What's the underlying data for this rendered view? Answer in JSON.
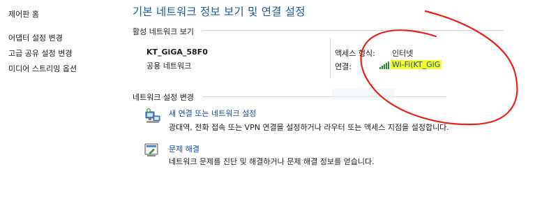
{
  "sidebar": {
    "control_panel_home": "제어판 홈",
    "items": [
      {
        "label": "어댑터 설정 변경"
      },
      {
        "label": "고급 공유 설정 변경"
      },
      {
        "label": "미디어 스트리밍 옵션"
      }
    ]
  },
  "main": {
    "title": "기본 네트워크 정보 보기 및 연결 설정",
    "active_networks": {
      "header": "활성 네트워크 보기",
      "network_name": "KT_GiGA_58F0",
      "network_category": "공용 네트워크",
      "access_type_label": "액세스 형식:",
      "access_type_value": "인터넷",
      "connections_label": "연결:",
      "connection_value": "Wi-Fi(KT_GiG"
    },
    "change_settings": {
      "header": "네트워크 설정 변경",
      "tasks": [
        {
          "title": "새 연결 또는 네트워크 설정",
          "description": "광대역, 전화 접속 또는 VPN 연결을 설정하거나 라우터 또는 액세스 지점을 설정합니다.",
          "icon": "network-setup-icon"
        },
        {
          "title": "문제 해결",
          "description": "네트워크 문제를 진단 및 해결하거나 문제 해결 정보를 얻습니다.",
          "icon": "troubleshoot-icon"
        }
      ]
    }
  },
  "colors": {
    "title_blue": "#1c5a9c",
    "link_blue": "#1a4fa0",
    "highlight_yellow": "#f4f728",
    "annotation_red": "#e8221c"
  }
}
